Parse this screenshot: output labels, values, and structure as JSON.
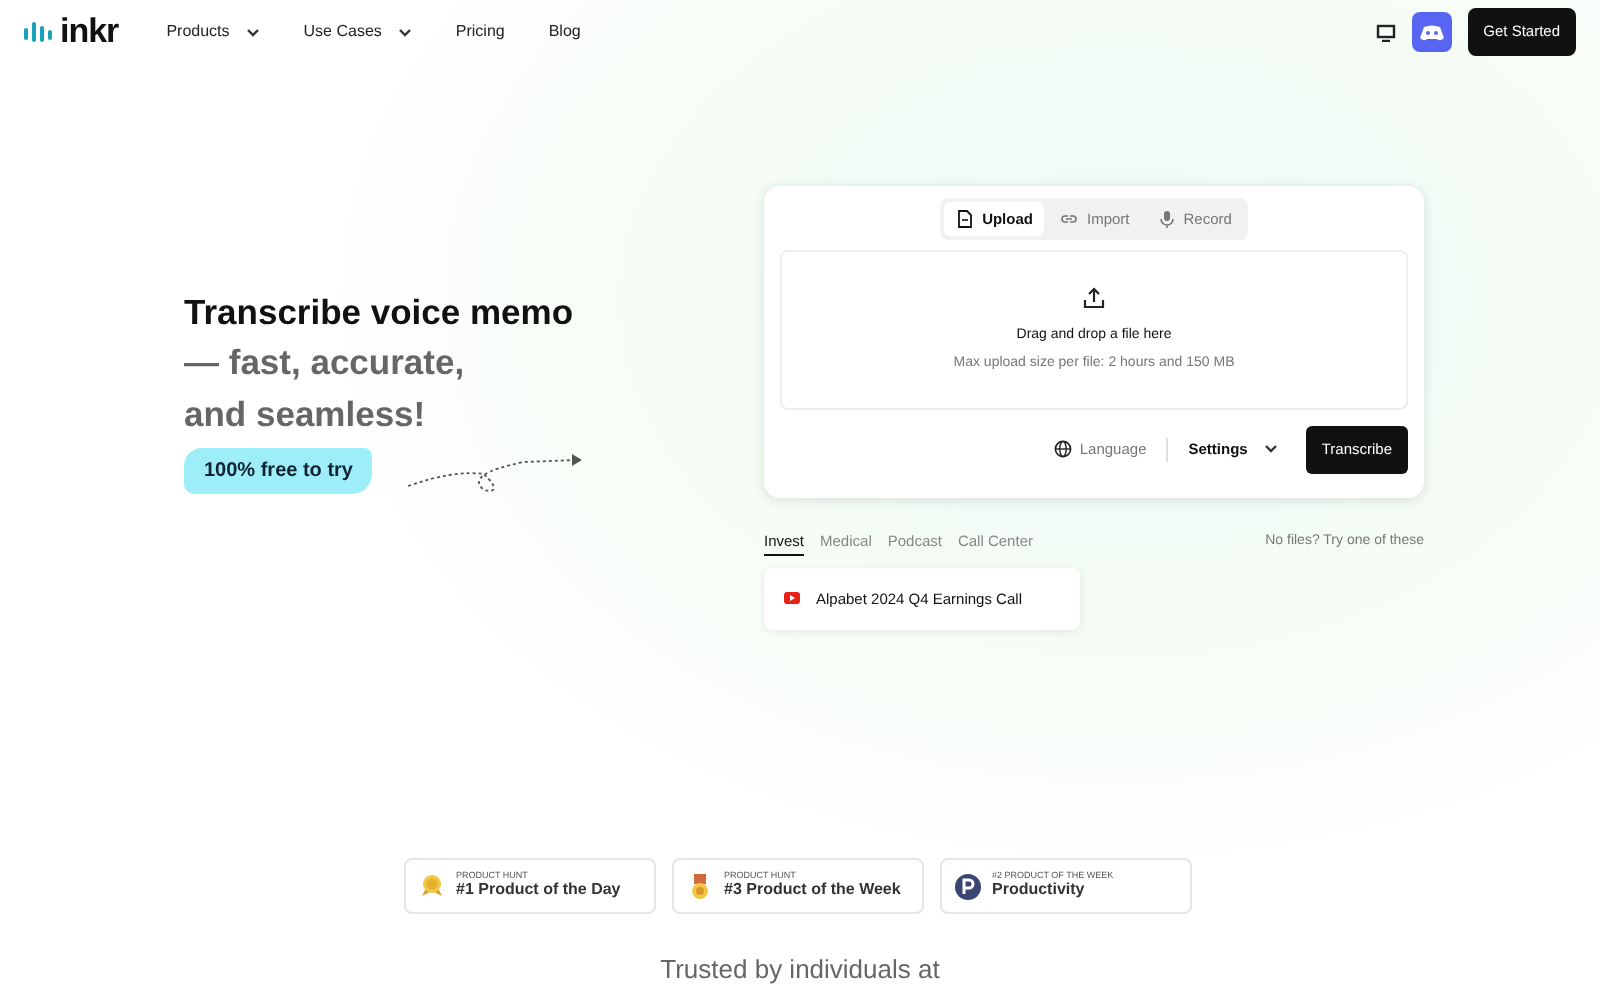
{
  "nav": {
    "logo": "inkr",
    "items": [
      {
        "label": "Products",
        "dropdown": true
      },
      {
        "label": "Use Cases",
        "dropdown": true
      },
      {
        "label": "Pricing",
        "dropdown": false
      },
      {
        "label": "Blog",
        "dropdown": false
      }
    ],
    "cta": "Get Started"
  },
  "hero": {
    "title": "Transcribe voice memo",
    "subtitle_lines": [
      "— fast, accurate,",
      "and seamless!"
    ],
    "free_badge": "100% free to try"
  },
  "uploader": {
    "tabs": [
      {
        "label": "Upload",
        "selected": true,
        "kind": "file"
      },
      {
        "label": "Import",
        "selected": false,
        "kind": "link"
      },
      {
        "label": "Record",
        "selected": false,
        "kind": "mic"
      }
    ],
    "drop_title": "Drag and drop a file here",
    "drop_hint": "Max upload size per file: 2 hours and 150 MB",
    "language": "Language",
    "settings": "Settings",
    "submit": "Transcribe"
  },
  "examples": {
    "categories": [
      {
        "label": "Invest",
        "selected": true
      },
      {
        "label": "Medical",
        "selected": false
      },
      {
        "label": "Podcast",
        "selected": false
      },
      {
        "label": "Call Center",
        "selected": false
      }
    ],
    "hint": "No files? Try one of these",
    "items": [
      {
        "title": "Alpabet 2024 Q4 Earnings Call"
      }
    ]
  },
  "awards": [
    {
      "kind": "gold-medal",
      "caption": "PRODUCT HUNT",
      "title": "#1 Product of the Day"
    },
    {
      "kind": "bronze-medal",
      "caption": "PRODUCT HUNT",
      "title": "#3 Product of the Week"
    },
    {
      "kind": "p-logo",
      "caption": "#2 PRODUCT OF THE WEEK",
      "title": "Productivity"
    }
  ],
  "trusted": "Trusted by individuals at"
}
